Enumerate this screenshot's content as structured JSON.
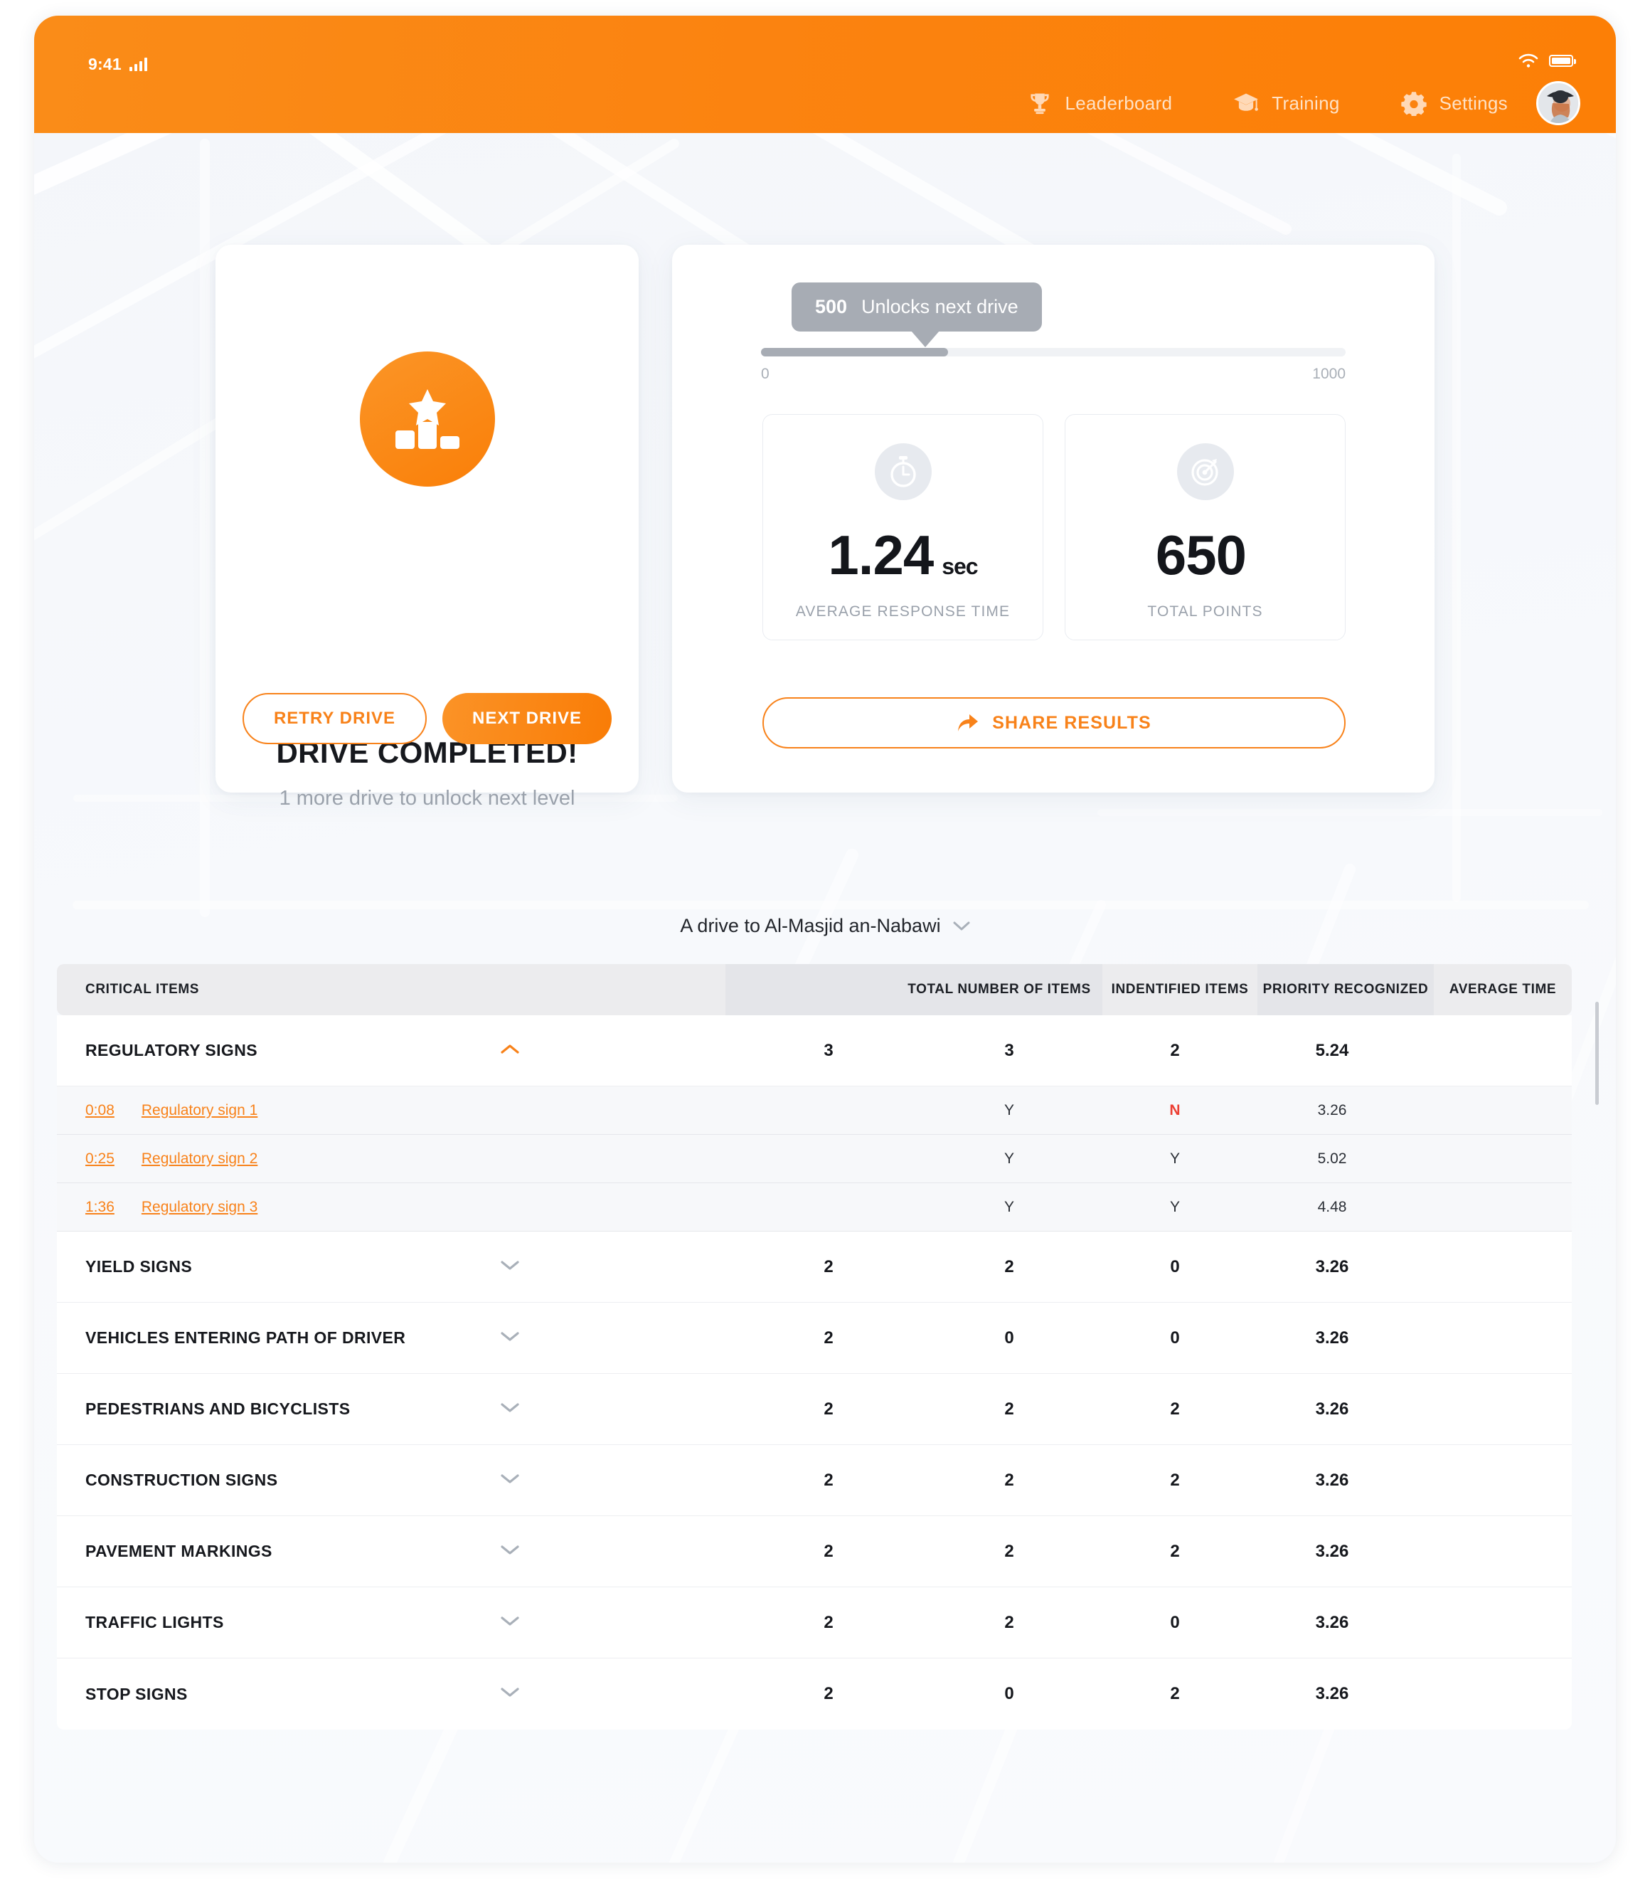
{
  "status_bar": {
    "time": "9:41",
    "signal_icon": "cellular-signal-icon",
    "wifi_icon": "wifi-icon",
    "battery_icon": "battery-icon"
  },
  "header": {
    "nav": [
      {
        "label": "Leaderboard",
        "icon": "trophy-icon"
      },
      {
        "label": "Training",
        "icon": "graduation-cap-icon"
      },
      {
        "label": "Settings",
        "icon": "gear-icon"
      }
    ],
    "avatar": "user-avatar"
  },
  "result_card": {
    "icon": "podium-star-icon",
    "title": "DRIVE COMPLETED!",
    "subtitle": "1 more drive to unlock next level",
    "retry_label": "RETRY DRIVE",
    "next_label": "NEXT DRIVE"
  },
  "progress_card": {
    "tooltip_value": "500",
    "tooltip_text": "Unlocks next drive",
    "min_label": "0",
    "max_label": "1000",
    "percent": 32,
    "stats": [
      {
        "icon": "stopwatch-icon",
        "value": "1.24",
        "unit": "sec",
        "label": "AVERAGE RESPONSE TIME"
      },
      {
        "icon": "target-dart-icon",
        "value": "650",
        "unit": "",
        "label": "TOTAL POINTS"
      }
    ],
    "share_label": "SHARE RESULTS",
    "share_icon": "share-arrow-icon"
  },
  "drive_selector": {
    "label": "A drive to Al-Masjid an-Nabawi",
    "icon": "chevron-down-icon"
  },
  "table": {
    "headers": [
      "CRITICAL ITEMS",
      "",
      "TOTAL NUMBER OF ITEMS",
      "INDENTIFIED ITEMS",
      "PRIORITY RECOGNIZED",
      "AVERAGE TIME"
    ],
    "rows": [
      {
        "name": "REGULATORY SIGNS",
        "expanded": true,
        "chevron": "chevron-up-icon",
        "total": "3",
        "identified": "3",
        "priority": "2",
        "average": "5.24",
        "children": [
          {
            "time": "0:08",
            "link": "Regulatory sign 1",
            "identified": "Y",
            "priority": "N",
            "priority_negative": true,
            "average": "3.26"
          },
          {
            "time": "0:25",
            "link": "Regulatory sign 2",
            "identified": "Y",
            "priority": "Y",
            "priority_negative": false,
            "average": "5.02"
          },
          {
            "time": "1:36",
            "link": "Regulatory sign 3",
            "identified": "Y",
            "priority": "Y",
            "priority_negative": false,
            "average": "4.48"
          }
        ]
      },
      {
        "name": "YIELD SIGNS",
        "expanded": false,
        "chevron": "chevron-down-icon",
        "total": "2",
        "identified": "2",
        "priority": "0",
        "average": "3.26",
        "children": []
      },
      {
        "name": "VEHICLES ENTERING PATH OF DRIVER",
        "expanded": false,
        "chevron": "chevron-down-icon",
        "total": "2",
        "identified": "0",
        "priority": "0",
        "average": "3.26",
        "children": []
      },
      {
        "name": "PEDESTRIANS AND BICYCLISTS",
        "expanded": false,
        "chevron": "chevron-down-icon",
        "total": "2",
        "identified": "2",
        "priority": "2",
        "average": "3.26",
        "children": []
      },
      {
        "name": "CONSTRUCTION SIGNS",
        "expanded": false,
        "chevron": "chevron-down-icon",
        "total": "2",
        "identified": "2",
        "priority": "2",
        "average": "3.26",
        "children": []
      },
      {
        "name": "PAVEMENT MARKINGS",
        "expanded": false,
        "chevron": "chevron-down-icon",
        "total": "2",
        "identified": "2",
        "priority": "2",
        "average": "3.26",
        "children": []
      },
      {
        "name": "TRAFFIC LIGHTS",
        "expanded": false,
        "chevron": "chevron-down-icon",
        "total": "2",
        "identified": "2",
        "priority": "0",
        "average": "3.26",
        "children": []
      },
      {
        "name": "STOP SIGNS",
        "expanded": false,
        "chevron": "chevron-down-icon",
        "total": "2",
        "identified": "0",
        "priority": "2",
        "average": "3.26",
        "children": []
      }
    ]
  },
  "colors": {
    "brand_orange": "#f8821a",
    "header_orange": "#fb8310",
    "negative_red": "#ec3f33",
    "muted_grey": "#a7acb4"
  }
}
